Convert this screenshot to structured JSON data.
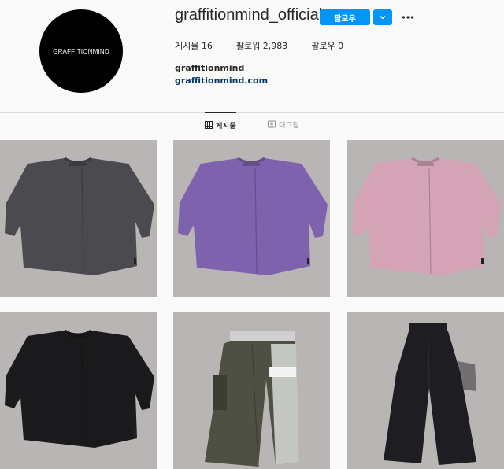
{
  "profile": {
    "avatar_text": "GRAFFITIONMIND",
    "username": "graffitionmind_official",
    "follow_label": "팔로우",
    "stats": {
      "posts_label": "게시물",
      "posts_count": "16",
      "followers_label": "팔로워",
      "followers_count": "2,983",
      "following_label": "팔로우",
      "following_count": "0"
    },
    "full_name": "graffitionmind",
    "website": "graffitionmind.com"
  },
  "tabs": {
    "posts_label": "게시물",
    "tagged_label": "태그됨"
  },
  "posts": [
    {
      "item": "tshirt",
      "color": "#4a4a4f"
    },
    {
      "item": "tshirt",
      "color": "#7e62ad"
    },
    {
      "item": "tshirt",
      "color": "#d4a3b6"
    },
    {
      "item": "tshirt",
      "color": "#1a1a1c"
    },
    {
      "item": "cargo-pants",
      "color": "#4e5043"
    },
    {
      "item": "wide-pants",
      "color": "#1e1e22"
    }
  ],
  "colors": {
    "accent": "#0095f6",
    "tile_background": "#b8b5b4",
    "link": "#00376b"
  }
}
